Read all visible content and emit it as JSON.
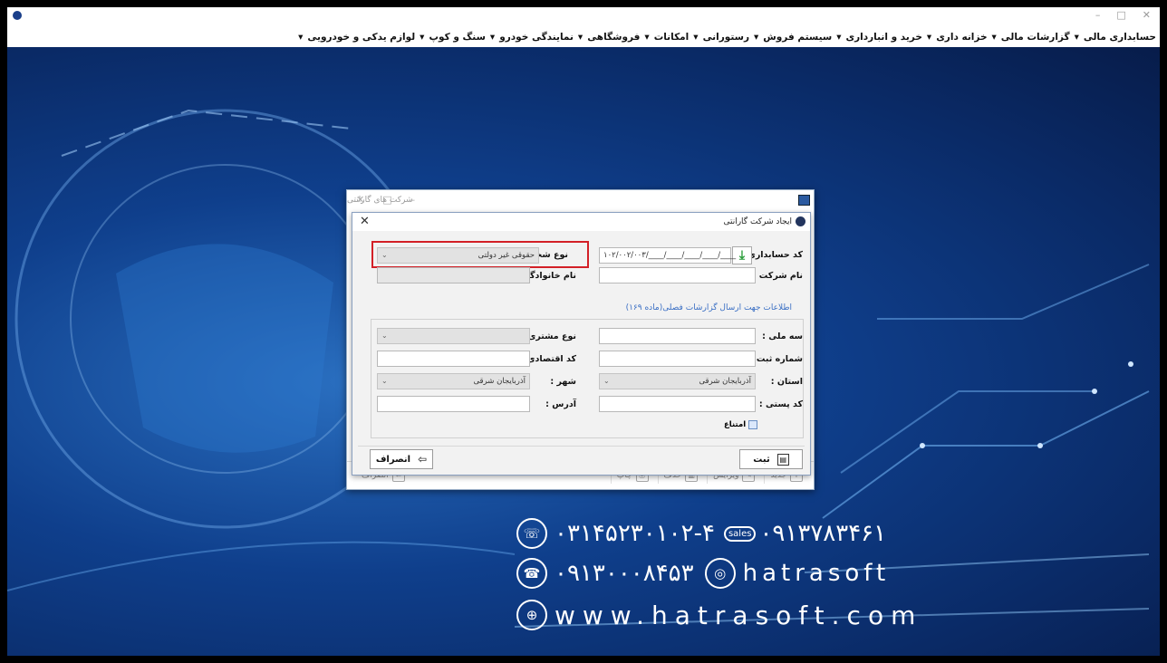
{
  "menu": [
    "حسابداری مالی",
    "گزارشات مالی",
    "خزانه داری",
    "خرید و انبارداری",
    "سیستم فروش",
    "رستورانی",
    "امکانات",
    "فروشگاهی",
    "نمایندگی خودرو",
    "سنگ و کوپ",
    "لوازم یدکی و خودرویی"
  ],
  "window_controls": {
    "minimize": "–",
    "maximize": "□",
    "close": "✕"
  },
  "parent_window": {
    "title": "شرکت های گارانتی",
    "toolbar": {
      "new": "جدید",
      "edit": "ویرایش",
      "delete": "حذف",
      "print": "چاپ",
      "cancel": "انصراف"
    }
  },
  "dialog": {
    "title": "ایجاد شرکت گارانتی",
    "account_code_label": "کد حسابداری :",
    "account_code_value": "۱۰۲/۰۰۲/۰۰۳/____/____/____/____/____",
    "person_type_label": "نوع شخص :",
    "person_type_value": "حقوقی غیر دولتی",
    "company_name_label": "نام شرکت :",
    "family_name_label": "نام خانوادگی :",
    "section_title": "اطلاعات جهت ارسال گزارشات فصلی(ماده ۱۶۹)",
    "national_id_label": "سه ملی :",
    "customer_type_label": "نوع مشتری :",
    "reg_no_label": "شماره ثبت :",
    "economic_code_label": "کد اقتصادی :",
    "province_label": "استان :",
    "province_value": "آذربایجان شرقی",
    "city_label": "شهر :",
    "city_value": "آذربایجان شرقی",
    "postal_code_label": "کد پستی :",
    "address_label": "آدرس :",
    "refrain_label": "امتناع",
    "save_button": "ثبت",
    "cancel_button": "انصراف"
  },
  "contacts": {
    "phone1": "۰۳۱۴۵۲۳۰۱۰۲-۴",
    "sales_badge": "sales",
    "phone2": "۰۹۱۳۷۸۳۴۶۱",
    "phone3": "۰۹۱۳۰۰۰۸۴۵۳",
    "instagram": "hatrasoft",
    "website": "www.hatrasoft.com"
  },
  "colors": {
    "highlight": "#d32027",
    "background": "#0f3f8c",
    "section_header": "#3a6fc4"
  }
}
